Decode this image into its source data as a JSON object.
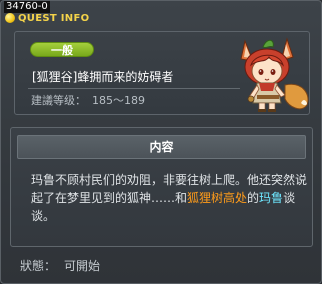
{
  "window": {
    "quest_id": "34760-0",
    "title": "QUEST INFO"
  },
  "quest": {
    "category": "一般",
    "name": "[狐狸谷]蜂拥而来的妨碍者",
    "level_label": "建議等级：",
    "level_range": "185～189"
  },
  "content": {
    "header": "内容",
    "text_part1": "玛鲁不顾村民们的劝阻，非要往树上爬。他还突然说起了在梦里见到的狐神……和",
    "highlight_place": "狐狸树高处",
    "text_part2": "的",
    "highlight_npc": "玛鲁",
    "text_part3": "谈谈。",
    "colors": {
      "place": "#ff9c1a",
      "npc": "#6ee7ff"
    }
  },
  "status": {
    "label": "狀態：",
    "value": "可開始"
  },
  "icons": {
    "title_icon": "coin-icon",
    "portrait": "fox-girl-npc-portrait"
  }
}
